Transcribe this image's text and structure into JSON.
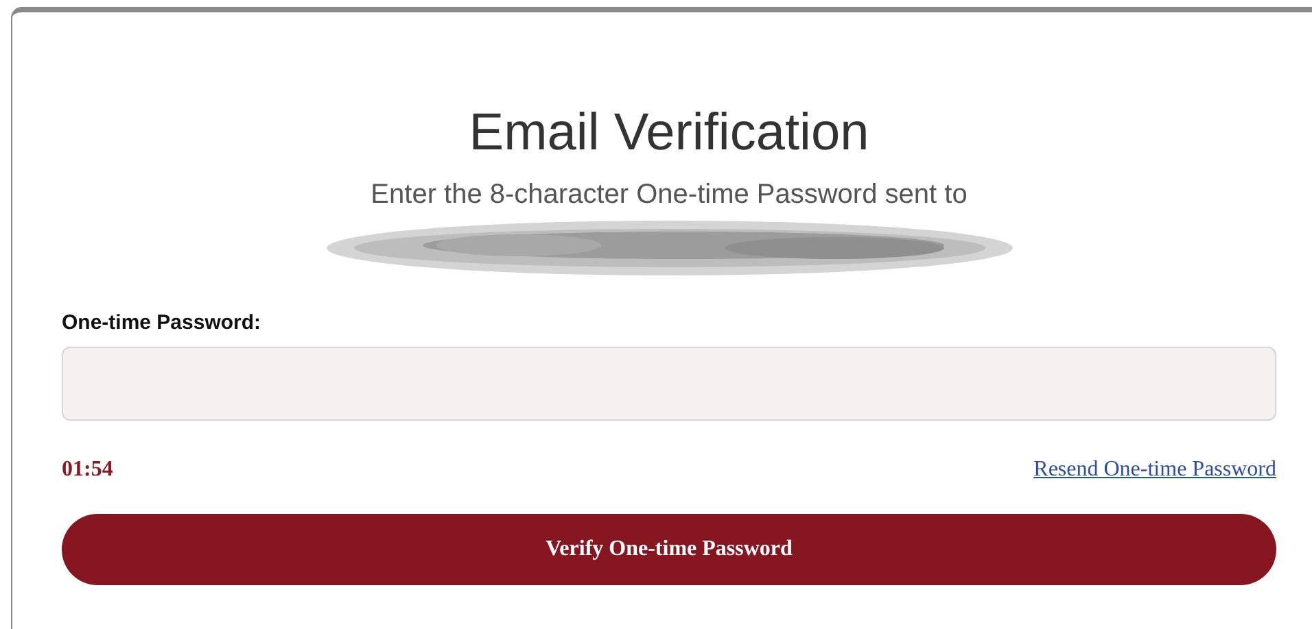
{
  "title": "Email Verification",
  "instruction": "Enter the 8-character One-time Password sent to",
  "recipient_redacted": true,
  "field": {
    "label": "One-time Password:"
  },
  "timer": "01:54",
  "resend_link": "Resend One-time Password",
  "submit_button": "Verify One-time Password"
}
